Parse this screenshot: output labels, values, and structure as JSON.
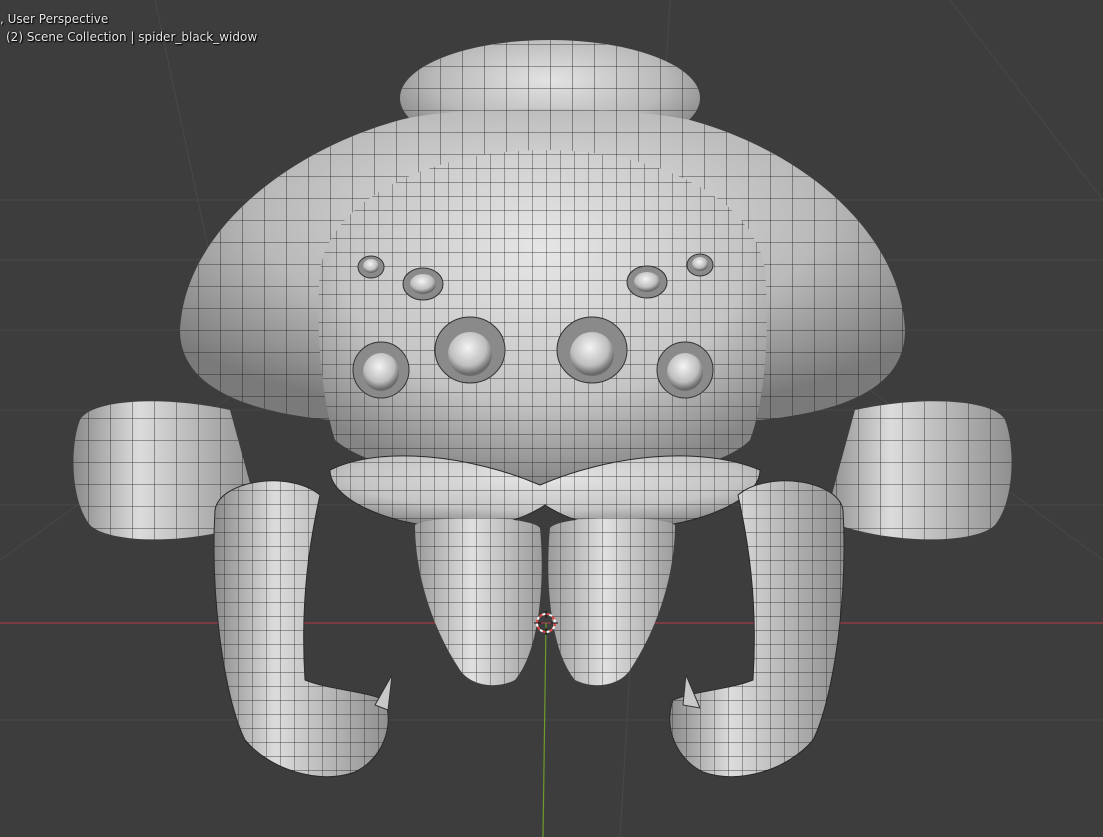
{
  "viewport": {
    "view_mode_label": ", User Perspective",
    "collection_label": "(2) Scene Collection | spider_black_widow"
  },
  "colors": {
    "background": "#3d3d3d",
    "grid_line": "#484848",
    "x_axis": "#a23a45",
    "y_axis": "#6f9a2c",
    "mesh_base": "#b9b9b9",
    "mesh_highlight": "#e3e3e3",
    "mesh_shadow": "#6e6e6e",
    "wire": "#1a1a1a",
    "cursor_red": "#e04848",
    "cursor_white": "#ffffff"
  },
  "icons": {
    "3d_cursor": "3d-cursor-icon"
  }
}
